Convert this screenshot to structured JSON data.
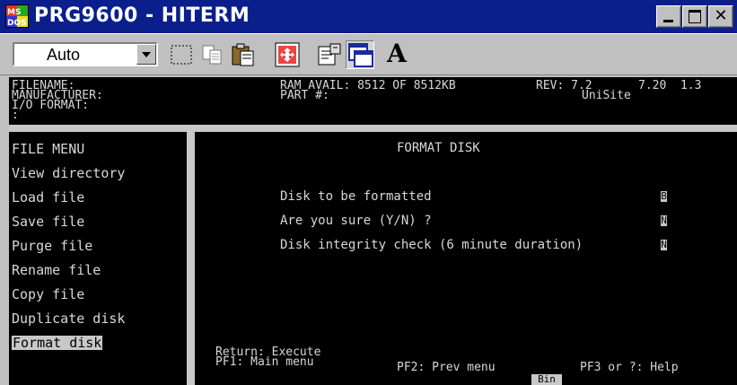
{
  "window": {
    "title": "PRG9600 - HITERM",
    "icon_text": "MS DOS",
    "controls": [
      "minimize",
      "maximize",
      "close"
    ]
  },
  "toolbar": {
    "font_select": "Auto",
    "buttons": [
      "mark-icon",
      "copy-icon",
      "paste-icon",
      "fullscreen-icon",
      "properties-icon",
      "background-icon",
      "font-icon"
    ],
    "font_button_label": "A"
  },
  "header": {
    "line1_left": "FILENAME:",
    "line2_left": "MANUFACTURER:",
    "line3_left": "I/O FORMAT:",
    "line4_left": ":",
    "ram": "RAM AVAIL: 8512 OF 8512KB",
    "part": "PART #:",
    "rev": "REV: 7.2",
    "rev_values": "7.20  1.3",
    "site": "UniSite"
  },
  "file_menu": {
    "title": "FILE MENU",
    "items": [
      {
        "label": "View directory",
        "selected": false
      },
      {
        "label": "Load file",
        "selected": false
      },
      {
        "label": "Save file",
        "selected": false
      },
      {
        "label": "Purge file",
        "selected": false
      },
      {
        "label": "Rename file",
        "selected": false
      },
      {
        "label": "Copy file",
        "selected": false
      },
      {
        "label": "Duplicate disk",
        "selected": false
      },
      {
        "label": "Format disk",
        "selected": true
      }
    ]
  },
  "format_panel": {
    "title": "FORMAT DISK",
    "prompts": [
      {
        "label": "Disk to be formatted",
        "value": "B"
      },
      {
        "label": "Are you sure (Y/N) ?",
        "value": "N"
      },
      {
        "label": "Disk integrity check (6 minute duration)",
        "value": "N"
      }
    ]
  },
  "footer": {
    "return_hint": "Return: Execute",
    "pf1": "PF1: Main menu",
    "pf2": "PF2: Prev menu",
    "pf3": "PF3 or ?: Help",
    "status": "Bin"
  },
  "colors": {
    "titlebar": "#0a1f8c",
    "terminal_bg": "#000000",
    "terminal_text": "#d8d8d8",
    "highlight": "#c8c8c8"
  }
}
